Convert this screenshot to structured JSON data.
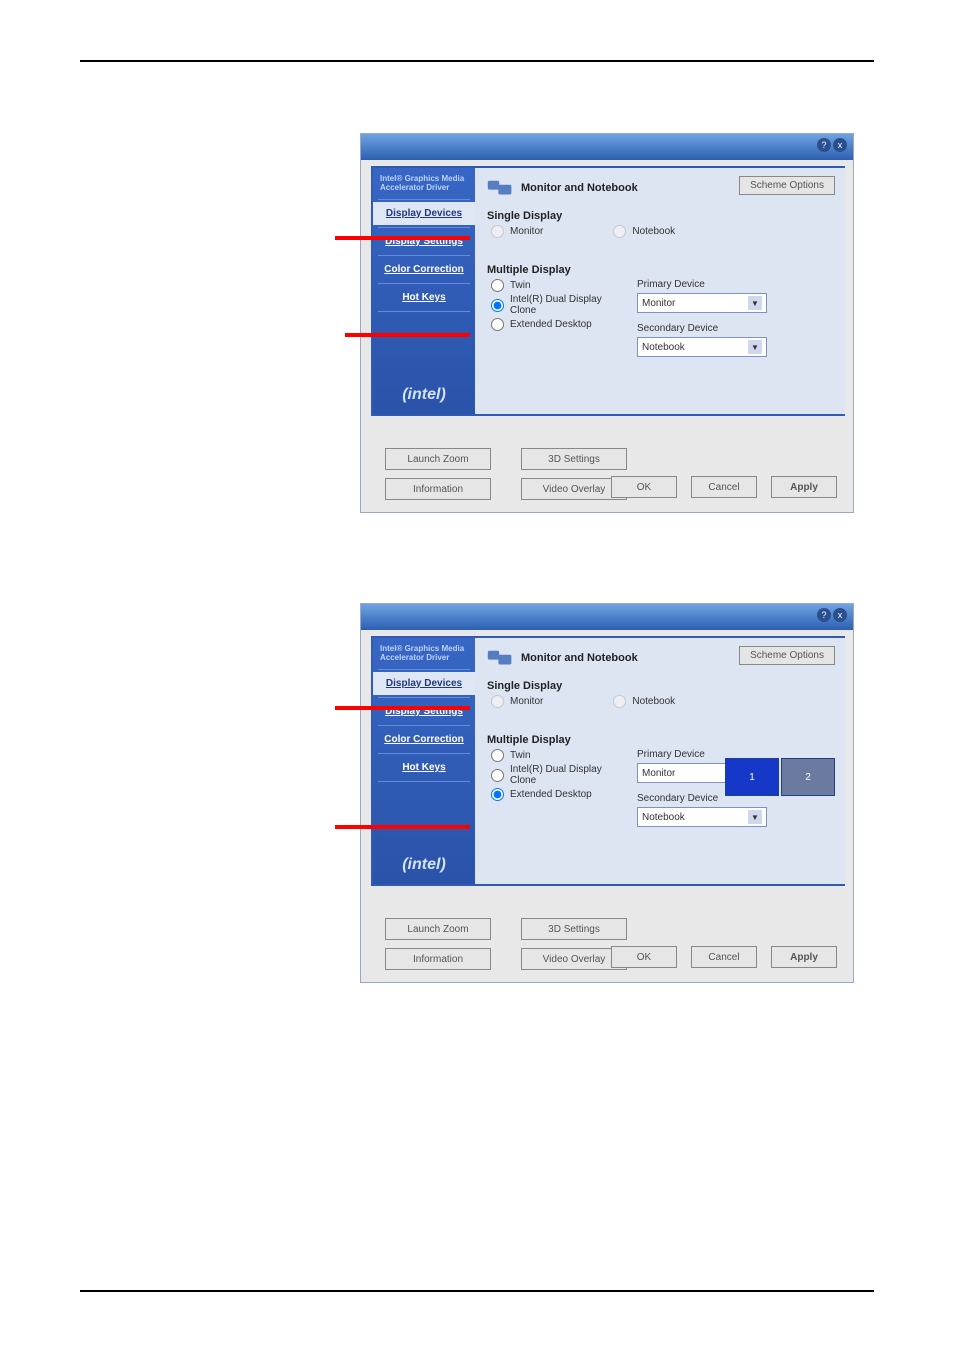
{
  "driver_name": "Intel®\nGraphics Media\nAccelerator Driver",
  "sidebar": {
    "items": [
      "Display Devices",
      "Display Settings",
      "Color Correction",
      "Hot Keys"
    ],
    "logo_text": "(intel)"
  },
  "panel_common": {
    "header": "Monitor and Notebook",
    "scheme_button": "Scheme Options",
    "single_display_label": "Single Display",
    "single_opts": [
      "Monitor",
      "Notebook"
    ],
    "multiple_display_label": "Multiple Display",
    "multi_opts": [
      "Twin",
      "Intel(R) Dual Display Clone",
      "Extended Desktop"
    ],
    "primary_label": "Primary Device",
    "secondary_label": "Secondary Device",
    "primary_value": "Monitor",
    "secondary_value": "Notebook"
  },
  "bottom_buttons": {
    "launch_zoom": "Launch Zoom",
    "settings_3d": "3D Settings",
    "information": "Information",
    "video_overlay": "Video Overlay"
  },
  "dialog_buttons": {
    "ok": "OK",
    "cancel": "Cancel",
    "apply": "Apply"
  },
  "panel1": {
    "multi_selected_index": 1
  },
  "panel2": {
    "multi_selected_index": 2,
    "preview_labels": [
      "1",
      "2"
    ]
  }
}
